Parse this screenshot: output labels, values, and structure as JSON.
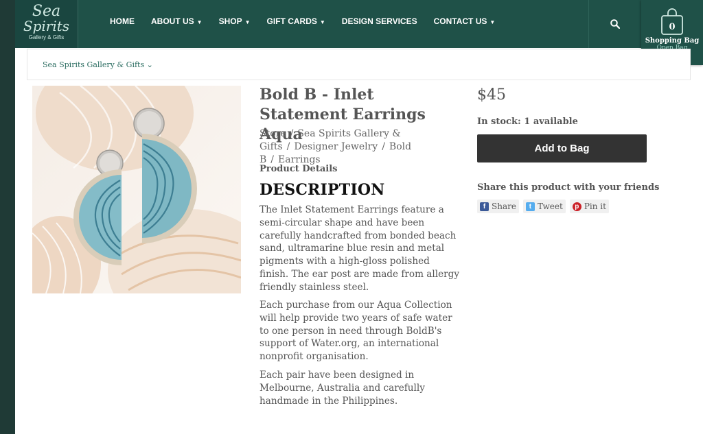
{
  "logo": {
    "line1": "Sea",
    "line2": "Spirits",
    "line3": "Gallery & Gifts"
  },
  "nav": {
    "items": [
      {
        "label": "HOME",
        "dropdown": false
      },
      {
        "label": "ABOUT US",
        "dropdown": true
      },
      {
        "label": "SHOP",
        "dropdown": true
      },
      {
        "label": "GIFT CARDS",
        "dropdown": true
      },
      {
        "label": "DESIGN SERVICES",
        "dropdown": false
      },
      {
        "label": "CONTACT US",
        "dropdown": true
      }
    ]
  },
  "bag": {
    "count": "0",
    "label": "Shopping Bag",
    "open": "Open Bag"
  },
  "breadcrumb": {
    "store": "Sea Spirits Gallery & Gifts"
  },
  "product": {
    "title": "Bold B - Inlet Statement Earrings Aqua",
    "crumbs": [
      "Store",
      "Sea Spirits Gallery & Gifts",
      "Designer Jewelry",
      "Bold B",
      "Earrings"
    ],
    "details_label": "Product Details",
    "desc_heading": "DESCRIPTION",
    "paragraphs": [
      "The Inlet Statement Earrings feature a semi-circular shape and have been carefully handcrafted from bonded beach sand, ultramarine blue resin and metal pigments with a high-gloss polished finish. The ear post are made from allergy friendly stainless steel.",
      "Each purchase from our Aqua Collection will help provide two years of safe water to one person in need through BoldB's support of Water.org, an international nonprofit organisation.",
      "Each pair have been designed in Melbourne, Australia and carefully handmade in the Philippines."
    ],
    "price": "$45",
    "stock": "In stock: 1 available",
    "add_button": "Add to Bag",
    "share_title": "Share this product with your friends",
    "share": {
      "facebook": "Share",
      "twitter": "Tweet",
      "pinterest": "Pin it"
    }
  },
  "colors": {
    "header": "#1f5148",
    "button": "#333333",
    "link": "#2a6c60"
  }
}
